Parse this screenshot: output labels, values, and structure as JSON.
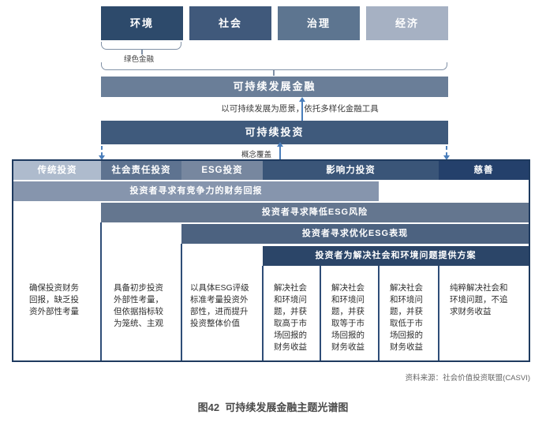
{
  "figure": {
    "caption": "图42  可持续发展金融主题光谱图",
    "source": "资料来源：社会价值投资联盟(CASVI)"
  },
  "esg_boxes": [
    {
      "label": "环境",
      "color": "#2d4a6b"
    },
    {
      "label": "社会",
      "color": "#40597b"
    },
    {
      "label": "治理",
      "color": "#5d7590"
    },
    {
      "label": "经济",
      "color": "#a6b1c3"
    }
  ],
  "green_finance": {
    "label": "绿色金融"
  },
  "sustainable_finance_bar": {
    "label": "可持续发展金融",
    "color": "#6a7e98",
    "note": "以可持续发展为愿景，依托多样化金融工具"
  },
  "sustainable_investment_bar": {
    "label": "可持续投资",
    "color": "#3f5a7c",
    "note": "概念覆盖"
  },
  "spectrum_table": {
    "columns": [
      {
        "label": "传统投资",
        "color": "#aebbcd"
      },
      {
        "label": "社会责任投资",
        "color": "#5e7390"
      },
      {
        "label": "ESG投资",
        "color": "#77879f"
      },
      {
        "label": "影响力投资",
        "color": "#3a5578"
      },
      {
        "label": "慈善",
        "color": "#24406b"
      }
    ],
    "goal_bars": [
      {
        "label": "投资者寻求有竞争力的财务回报",
        "color": "#8695ad"
      },
      {
        "label": "投资者寻求降低ESG风险",
        "color": "#64768f"
      },
      {
        "label": "投资者寻求优化ESG表现",
        "color": "#4c6280"
      },
      {
        "label": "投资者为解决社会和环境问题提供方案",
        "color": "#2b4568"
      }
    ],
    "descriptions": [
      "确保投资财务回报，缺乏投资外部性考量",
      "具备初步投资外部性考量，但依据指标较为笼统、主观",
      "以具体ESG评级标准考量投资外部性，进而提升投资整体价值",
      "解决社会和环境问题，并获取高于市场回报的财务收益",
      "解决社会和环境问题，并获取等于市场回报的财务收益",
      "解决社会和环境问题，并获取低于市场回报的财务收益",
      "纯粹解决社会和环境问题，不追求财务收益"
    ]
  },
  "colors": {
    "connector_blue": "#4a7ebb",
    "bracket": "#8191a6",
    "table_border": "#1e3a5f",
    "cell_border": "#2e4d77"
  }
}
